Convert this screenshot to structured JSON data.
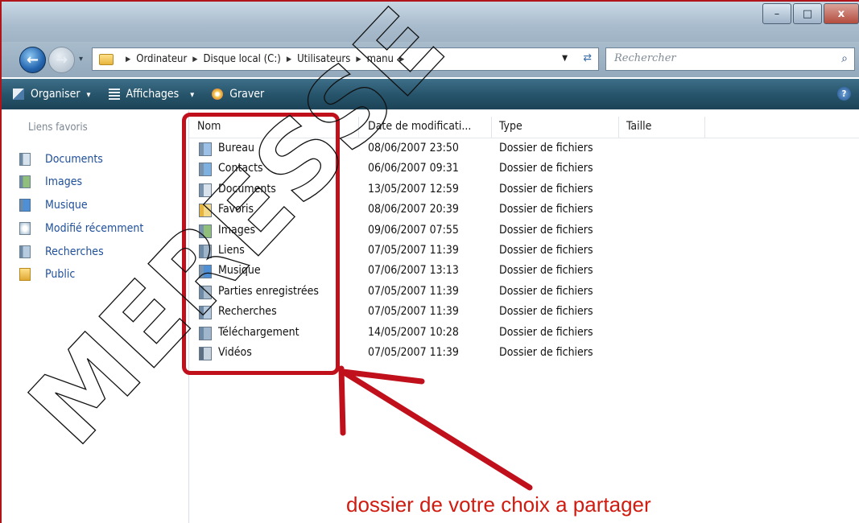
{
  "window": {
    "buttons": {
      "minimize": "–",
      "maximize": "□",
      "close": "x"
    }
  },
  "address_bar": {
    "crumbs": [
      "Ordinateur",
      "Disque local (C:)",
      "Utilisateurs",
      "manu"
    ]
  },
  "search": {
    "placeholder": "Rechercher"
  },
  "toolbar": {
    "organize": "Organiser",
    "views": "Affichages",
    "burn": "Graver",
    "dropdown_glyph": "▾"
  },
  "sidebar": {
    "heading": "Liens favoris",
    "items": [
      {
        "label": "Documents",
        "icon": "documents-icon"
      },
      {
        "label": "Images",
        "icon": "images-icon"
      },
      {
        "label": "Musique",
        "icon": "music-icon"
      },
      {
        "label": "Modifié récemment",
        "icon": "recent-icon"
      },
      {
        "label": "Recherches",
        "icon": "search-folder-icon"
      },
      {
        "label": "Public",
        "icon": "folder-icon"
      }
    ]
  },
  "columns": [
    "Nom",
    "Date de modificati...",
    "Type",
    "Taille"
  ],
  "files": [
    {
      "name": "Bureau",
      "date": "08/06/2007 23:50",
      "type": "Dossier de fichiers",
      "icon": "desktop-folder-icon"
    },
    {
      "name": "Contacts",
      "date": "06/06/2007 09:31",
      "type": "Dossier de fichiers",
      "icon": "contacts-folder-icon"
    },
    {
      "name": "Documents",
      "date": "13/05/2007 12:59",
      "type": "Dossier de fichiers",
      "icon": "documents-folder-icon"
    },
    {
      "name": "Favoris",
      "date": "08/06/2007 20:39",
      "type": "Dossier de fichiers",
      "icon": "favorites-folder-icon"
    },
    {
      "name": "Images",
      "date": "09/06/2007 07:55",
      "type": "Dossier de fichiers",
      "icon": "images-folder-icon"
    },
    {
      "name": "Liens",
      "date": "07/05/2007 11:39",
      "type": "Dossier de fichiers",
      "icon": "links-folder-icon"
    },
    {
      "name": "Musique",
      "date": "07/06/2007 13:13",
      "type": "Dossier de fichiers",
      "icon": "music-folder-icon"
    },
    {
      "name": "Parties enregistrées",
      "date": "07/05/2007 11:39",
      "type": "Dossier de fichiers",
      "icon": "saved-games-folder-icon"
    },
    {
      "name": "Recherches",
      "date": "07/05/2007 11:39",
      "type": "Dossier de fichiers",
      "icon": "searches-folder-icon"
    },
    {
      "name": "Téléchargement",
      "date": "14/05/2007 10:28",
      "type": "Dossier de fichiers",
      "icon": "downloads-folder-icon"
    },
    {
      "name": "Vidéos",
      "date": "07/05/2007 11:39",
      "type": "Dossier de fichiers",
      "icon": "videos-folder-icon"
    }
  ],
  "annotation": {
    "caption": "dossier de votre choix a partager",
    "color": "#c0101c"
  },
  "watermark": {
    "text": "MERESSE"
  }
}
